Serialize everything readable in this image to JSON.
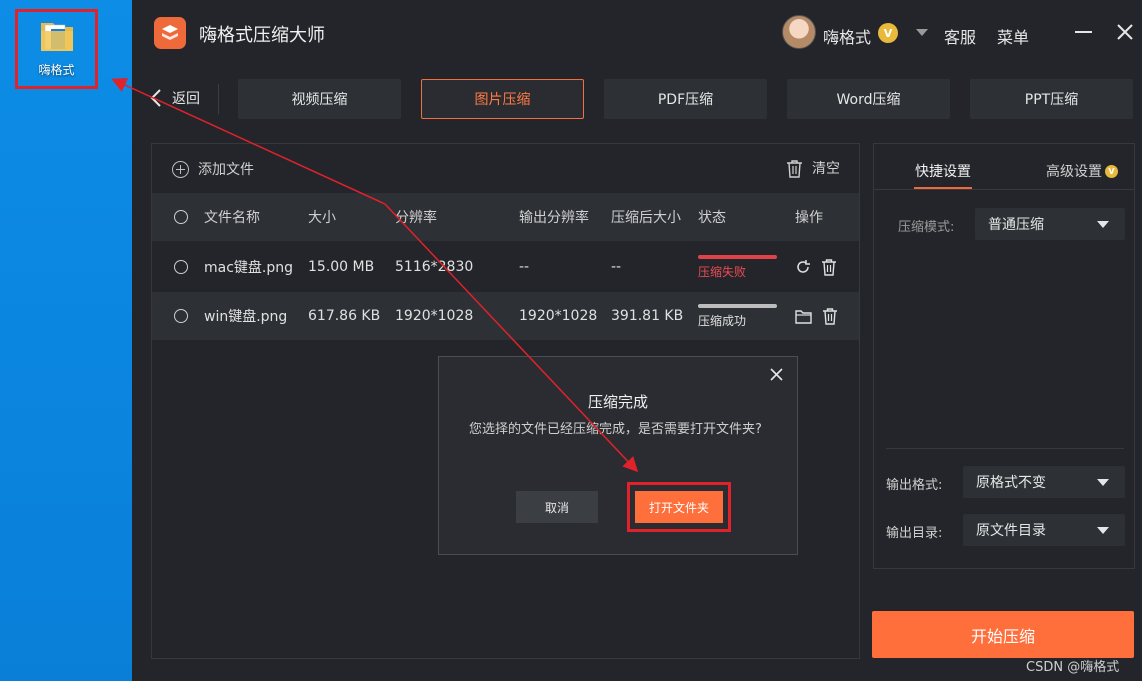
{
  "desktop": {
    "icon_label": "嗨格式"
  },
  "app": {
    "title": "嗨格式压缩大师",
    "user": {
      "name": "嗨格式",
      "vip_badge": "V"
    },
    "service_label": "客服",
    "menu_label": "菜单"
  },
  "nav": {
    "back_label": "返回",
    "tabs": [
      {
        "label": "视频压缩",
        "active": false
      },
      {
        "label": "图片压缩",
        "active": true
      },
      {
        "label": "PDF压缩",
        "active": false
      },
      {
        "label": "Word压缩",
        "active": false
      },
      {
        "label": "PPT压缩",
        "active": false
      }
    ]
  },
  "main": {
    "add_file_label": "添加文件",
    "clear_label": "清空",
    "columns": [
      "文件名称",
      "大小",
      "分辨率",
      "输出分辨率",
      "压缩后大小",
      "状态",
      "操作"
    ],
    "rows": [
      {
        "name": "mac键盘.png",
        "size": "15.00 MB",
        "resolution": "5116*2830",
        "output_resolution": "--",
        "compressed_size": "--",
        "status": "压缩失败",
        "status_color": "#ec4b53"
      },
      {
        "name": "win键盘.png",
        "size": "617.86 KB",
        "resolution": "1920*1028",
        "output_resolution": "1920*1028",
        "compressed_size": "391.81 KB",
        "status": "压缩成功",
        "status_color": "#e0e0e0"
      }
    ]
  },
  "side": {
    "tab_quick": "快捷设置",
    "tab_advanced": "高级设置",
    "mode_label": "压缩模式:",
    "mode_value": "普通压缩",
    "format_label": "输出格式:",
    "format_value": "原格式不变",
    "dir_label": "输出目录:",
    "dir_value": "原文件目录",
    "start_label": "开始压缩"
  },
  "dialog": {
    "title": "压缩完成",
    "message": "您选择的文件已经压缩完成，是否需要打开文件夹?",
    "cancel_label": "取消",
    "open_label": "打开文件夹"
  },
  "watermark": "CSDN @嗨格式",
  "colors": {
    "accent": "#ff6f3c",
    "annotation_red": "#e0222a",
    "fail_red": "#ec4b53",
    "panel_bg": "#23252a"
  }
}
